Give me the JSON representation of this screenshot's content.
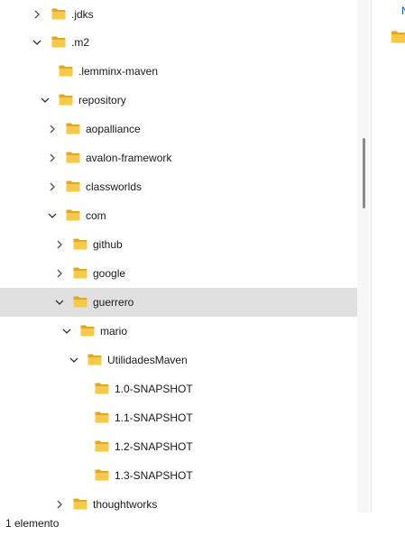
{
  "tree": {
    "items": [
      {
        "label": ".jdks",
        "state": "collapsed"
      },
      {
        "label": ".m2",
        "state": "expanded"
      },
      {
        "label": ".lemminx-maven",
        "state": "leaf"
      },
      {
        "label": "repository",
        "state": "expanded"
      },
      {
        "label": "aopalliance",
        "state": "collapsed"
      },
      {
        "label": "avalon-framework",
        "state": "collapsed"
      },
      {
        "label": "classworlds",
        "state": "collapsed"
      },
      {
        "label": "com",
        "state": "expanded"
      },
      {
        "label": "github",
        "state": "collapsed"
      },
      {
        "label": "google",
        "state": "collapsed"
      },
      {
        "label": "guerrero",
        "state": "expanded",
        "selected": true
      },
      {
        "label": "mario",
        "state": "expanded"
      },
      {
        "label": "UtilidadesMaven",
        "state": "expanded"
      },
      {
        "label": "1.0-SNAPSHOT",
        "state": "leaf"
      },
      {
        "label": "1.1-SNAPSHOT",
        "state": "leaf"
      },
      {
        "label": "1.2-SNAPSHOT",
        "state": "leaf"
      },
      {
        "label": "1.3-SNAPSHOT",
        "state": "leaf"
      },
      {
        "label": "thoughtworks",
        "state": "collapsed"
      }
    ]
  },
  "right_pane": {
    "partial_text": "N"
  },
  "status_bar": {
    "text": "1 elemento"
  },
  "colors": {
    "folder": "#f8c945",
    "folder_dark": "#e0a722",
    "selection": "#e0e0e0"
  },
  "icons": {
    "folder": "folder-icon",
    "collapsed": "chevron-right-icon",
    "expanded": "chevron-down-icon"
  }
}
